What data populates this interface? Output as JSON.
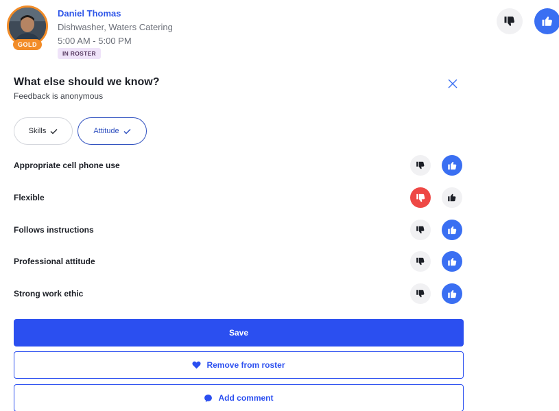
{
  "worker": {
    "name": "Daniel Thomas",
    "role": "Dishwasher, Waters Catering",
    "shift": "5:00 AM - 5:00 PM",
    "tier": "GOLD",
    "roster_status": "IN ROSTER"
  },
  "overall_rating": {
    "selected": "up"
  },
  "feedback": {
    "title": "What else should we know?",
    "subtitle": "Feedback is anonymous",
    "categories": [
      {
        "label": "Skills",
        "selected": true
      },
      {
        "label": "Attitude",
        "selected": true
      }
    ],
    "criteria": [
      {
        "label": "Appropriate cell phone use",
        "rating": "up"
      },
      {
        "label": "Flexible",
        "rating": "down"
      },
      {
        "label": "Follows instructions",
        "rating": "up"
      },
      {
        "label": "Professional attitude",
        "rating": "up"
      },
      {
        "label": "Strong work ethic",
        "rating": "up"
      }
    ]
  },
  "actions": {
    "save_label": "Save",
    "remove_label": "Remove from roster",
    "comment_label": "Add comment"
  },
  "colors": {
    "primary": "#2b4ff0",
    "thumb_up_active": "#3a6ff2",
    "thumb_down_active": "#ee4845",
    "gold": "#f28c28",
    "roster_pill_bg": "#efe3f9"
  },
  "icons": {
    "thumb_up": "thumbs-up-icon",
    "thumb_down": "thumbs-down-icon",
    "close": "close-icon",
    "check": "check-icon",
    "heart": "heart-icon",
    "comment": "speech-bubble-icon"
  }
}
